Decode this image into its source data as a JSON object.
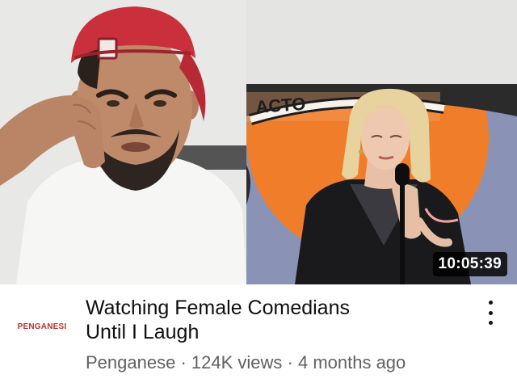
{
  "thumbnail": {
    "duration": "10:05:39",
    "sign_text": "ACTO"
  },
  "video": {
    "title_line1": "Watching Female Comedians",
    "title_line2": "Until I Laugh",
    "channel": "Penganese",
    "views": "124K views",
    "age": "4 months ago",
    "separator": " · "
  },
  "avatar": {
    "text": "PENGANESI"
  },
  "colors": {
    "title": "#0f0f0f",
    "meta": "#606060",
    "cap_red": "#c9303b",
    "sign_orange": "#f07d2a"
  }
}
